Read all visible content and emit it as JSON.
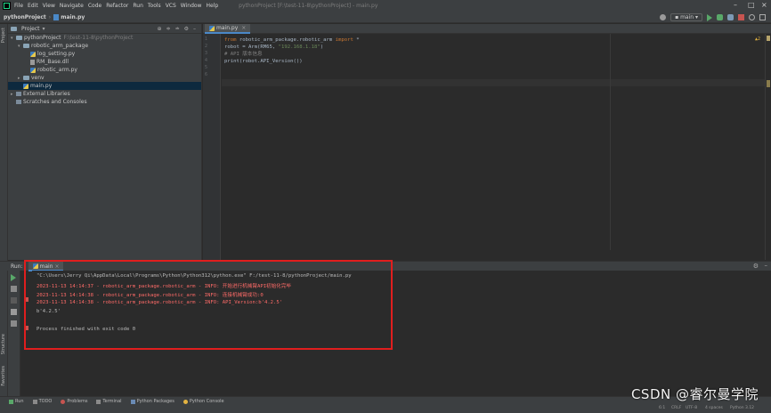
{
  "menu": [
    "File",
    "Edit",
    "View",
    "Navigate",
    "Code",
    "Refactor",
    "Run",
    "Tools",
    "VCS",
    "Window",
    "Help"
  ],
  "window_title": "pythonProject [F:\\test-11-8\\pythonProject] - main.py",
  "navbar": {
    "project": "pythonProject",
    "file": "main.py",
    "run_config": "main"
  },
  "project_panel": {
    "title": "Project",
    "tree": [
      {
        "label": "pythonProject",
        "path": "F:\\test-11-8\\pythonProject",
        "indent": 0,
        "arrow": "▾",
        "icon": "folder"
      },
      {
        "label": "robotic_arm_package",
        "indent": 1,
        "arrow": "▾",
        "icon": "folder"
      },
      {
        "label": "log_setting.py",
        "indent": 2,
        "arrow": "",
        "icon": "py"
      },
      {
        "label": "RM_Base.dll",
        "indent": 2,
        "arrow": "",
        "icon": "dll"
      },
      {
        "label": "robotic_arm.py",
        "indent": 2,
        "arrow": "",
        "icon": "py"
      },
      {
        "label": "venv",
        "indent": 1,
        "arrow": "▸",
        "icon": "folder"
      },
      {
        "label": "main.py",
        "indent": 1,
        "arrow": "",
        "icon": "py",
        "selected": true
      },
      {
        "label": "External Libraries",
        "indent": 0,
        "arrow": "▸",
        "icon": "lib"
      },
      {
        "label": "Scratches and Consoles",
        "indent": 0,
        "arrow": "",
        "icon": "lib"
      }
    ]
  },
  "editor": {
    "tab": "main.py",
    "line_numbers": [
      "1",
      "2",
      "3",
      "4",
      "5",
      "6"
    ],
    "inspection": "▲2",
    "lines": [
      [
        {
          "t": "from ",
          "c": "kw"
        },
        {
          "t": "robotic_arm_package.robotic_arm ",
          "c": "id"
        },
        {
          "t": "import",
          "c": "kw"
        },
        {
          "t": " *",
          "c": "id"
        }
      ],
      [
        {
          "t": "robot = Arm(RM65, ",
          "c": "id"
        },
        {
          "t": "\"192.168.1.18\"",
          "c": "str"
        },
        {
          "t": ")",
          "c": "id"
        }
      ],
      [
        {
          "t": "# API 版本信息",
          "c": "cmt"
        }
      ],
      [
        {
          "t": "print(robot.API_Version())",
          "c": "id"
        }
      ],
      [],
      []
    ]
  },
  "run_panel": {
    "label": "Run:",
    "tab": "main",
    "console": [
      {
        "text": "\"C:\\Users\\Jerry Qi\\AppData\\Local\\Programs\\Python\\Python312\\python.exe\" F:/test-11-8/pythonProject/main.py",
        "style": "normal"
      },
      {
        "text": "2023-11-13 14:14:37 - robotic_arm_package.robotic_arm - INFO: 开始进行机械臂API初始化完毕",
        "style": "err"
      },
      {
        "text": "2023-11-13 14:14:38 - robotic_arm_package.robotic_arm - INFO: 连接机械臂成功:0",
        "style": "err"
      },
      {
        "text": "2023-11-13 14:14:38 - robotic_arm_package.robotic_arm - INFO: API_Version:b'4.2.5'",
        "style": "err"
      },
      {
        "text": "b'4.2.5'",
        "style": "normal"
      },
      {
        "text": "",
        "style": "normal"
      },
      {
        "text": "Process finished with exit code 0",
        "style": "normal"
      }
    ]
  },
  "bottom_tools": [
    "Run",
    "TODO",
    "Problems",
    "Terminal",
    "Python Packages",
    "Python Console"
  ],
  "side_labels": {
    "project": "Project",
    "structure": "Structure",
    "favorites": "Favorites"
  },
  "status": {
    "position": "6:1",
    "line_sep": "CRLF",
    "encoding": "UTF-8",
    "indent": "4 spaces",
    "interpreter": "Python 3.12"
  },
  "watermark": "CSDN @睿尔曼学院",
  "colors": {
    "accent": "#4a88c7",
    "highlight_box": "#e01e1e",
    "error_text": "#ff6b68"
  }
}
